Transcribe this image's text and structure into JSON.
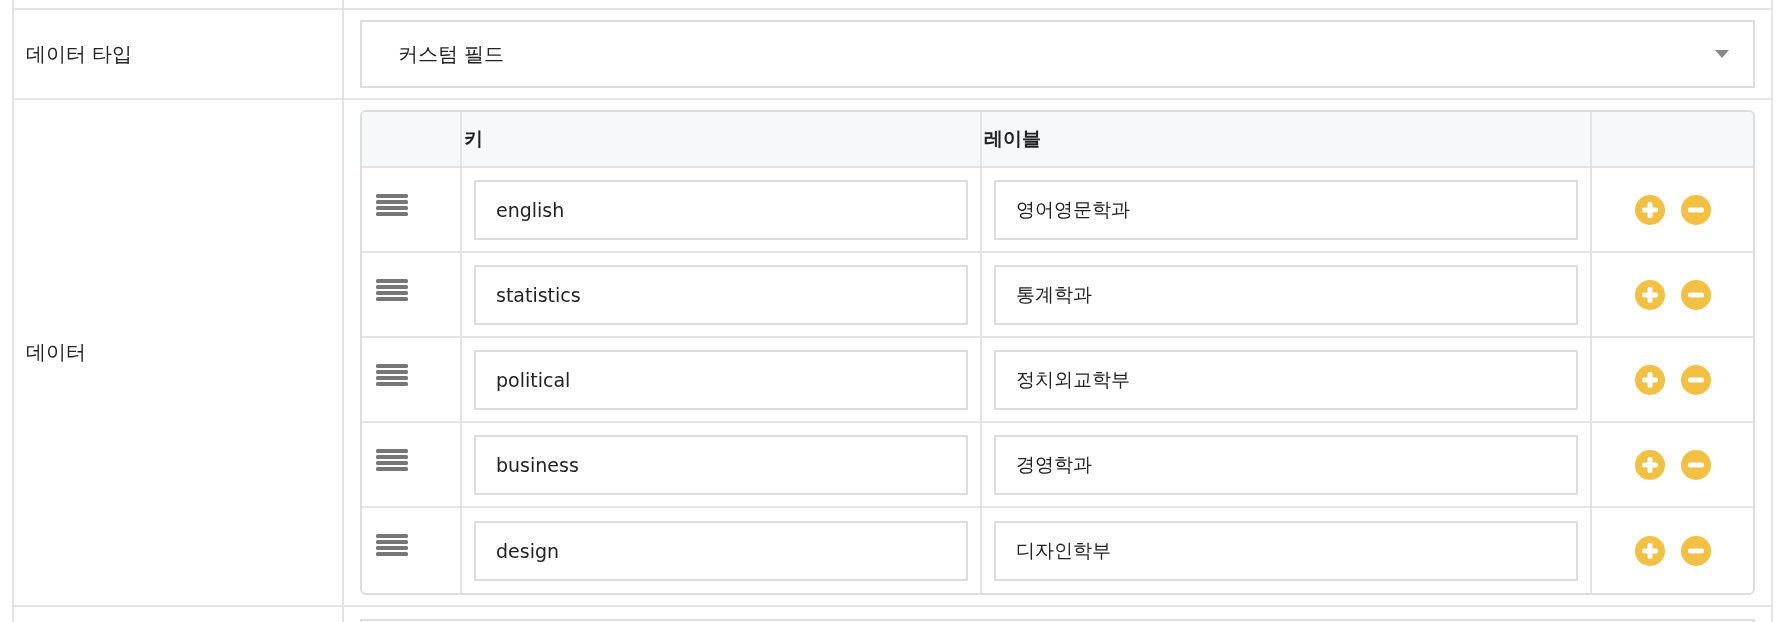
{
  "fields": [
    {
      "label": "데이터 타입",
      "kind": "select",
      "value": "커스텀 필드"
    },
    {
      "label": "데이터",
      "kind": "table",
      "columns": [
        "키",
        "레이블"
      ],
      "rows": [
        {
          "key": "english",
          "label": "영어영문학과"
        },
        {
          "key": "statistics",
          "label": "통계학과"
        },
        {
          "key": "political",
          "label": "정치외교학부"
        },
        {
          "key": "business",
          "label": "경영학과"
        },
        {
          "key": "design",
          "label": "디자인학부"
        }
      ]
    }
  ]
}
